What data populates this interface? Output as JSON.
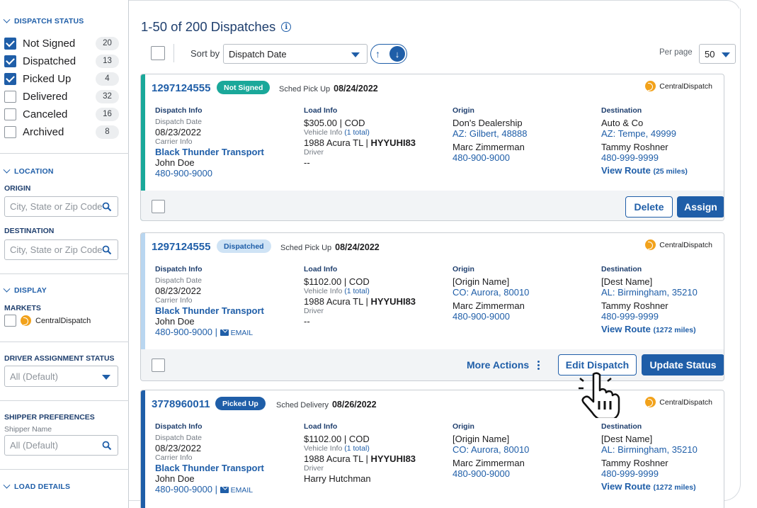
{
  "sidebar": {
    "dispatch_status": {
      "heading": "DISPATCH STATUS",
      "items": [
        {
          "label": "Not Signed",
          "count": "20",
          "checked": true
        },
        {
          "label": "Dispatched",
          "count": "13",
          "checked": true
        },
        {
          "label": "Picked Up",
          "count": "4",
          "checked": true
        },
        {
          "label": "Delivered",
          "count": "32",
          "checked": false
        },
        {
          "label": "Canceled",
          "count": "16",
          "checked": false
        },
        {
          "label": "Archived",
          "count": "8",
          "checked": false
        }
      ]
    },
    "location": {
      "heading": "LOCATION",
      "origin_label": "ORIGIN",
      "origin_placeholder": "City, State or Zip Code",
      "destination_label": "DESTINATION",
      "destination_placeholder": "City, State or Zip Code"
    },
    "display": {
      "heading": "DISPLAY",
      "markets_label": "MARKETS",
      "market_option": "CentralDispatch"
    },
    "driver_assignment": {
      "label": "DRIVER ASSIGNMENT STATUS",
      "value": "All (Default)"
    },
    "shipper": {
      "label": "SHIPPER PREFERENCES",
      "sub": "Shipper Name",
      "value": "All (Default)"
    },
    "load_details": {
      "heading": "LOAD DETAILS"
    }
  },
  "header": {
    "title": "1-50 of 200 Dispatches",
    "info_icon": "i",
    "sort_label": "Sort by",
    "sort_value": "Dispatch Date",
    "per_page_label": "Per page",
    "per_page_value": "50"
  },
  "brand": {
    "logo_text": "CentralDispatch",
    "accent": "#1f5ea8",
    "logo_color": "#f2a21b"
  },
  "cards": [
    {
      "id": "1297124555",
      "status": "Not Signed",
      "status_bg": "#1aa89a",
      "status_fg": "#ffffff",
      "accent": "#1aa89a",
      "sched_label": "Sched Pick Up",
      "sched_date": "08/24/2022",
      "dispatch": {
        "heading": "Dispatch Info",
        "date_label": "Dispatch Date",
        "date": "08/23/2022",
        "carrier_label": "Carrier Info",
        "carrier": "Black Thunder Transport",
        "contact": "John Doe",
        "phone": "480-900-9000",
        "email": ""
      },
      "load": {
        "heading": "Load Info",
        "price": "$305.00 | COD",
        "vehicle_label": "Vehicle Info",
        "vehicle_total": "(1 total)",
        "vehicle_model": "1988 Acura TL | ",
        "vehicle_plate": "HYYUHI83",
        "driver_label": "Driver",
        "driver": "--"
      },
      "origin": {
        "heading": "Origin",
        "name": "Don's Dealership",
        "location": "AZ: Gilbert, 48888",
        "contact": "Marc Zimmerman",
        "phone": "480-900-9000"
      },
      "destination": {
        "heading": "Destination",
        "name": "Auto & Co",
        "location": "AZ: Tempe, 49999",
        "contact": "Tammy Roshner",
        "phone": "480-999-9999",
        "route": "View Route",
        "miles": "(25 miles)"
      },
      "actions": {
        "delete": "Delete",
        "assign": "Assign"
      }
    },
    {
      "id": "1297124555",
      "status": "Dispatched",
      "status_bg": "#cfe3f5",
      "status_fg": "#1f5ea8",
      "accent": "#b9d6f0",
      "sched_label": "Sched Pick Up",
      "sched_date": "08/24/2022",
      "dispatch": {
        "heading": "Dispatch Info",
        "date_label": "Dispatch Date",
        "date": "08/23/2022",
        "carrier_label": "Carrier Info",
        "carrier": "Black Thunder Transport",
        "contact": "John Doe",
        "phone": "480-900-9000 | ",
        "email": "EMAIL"
      },
      "load": {
        "heading": "Load Info",
        "price": "$1102.00 | COD",
        "vehicle_label": "Vehicle Info",
        "vehicle_total": "(1 total)",
        "vehicle_model": "1988 Acura TL | ",
        "vehicle_plate": "HYYUHI83",
        "driver_label": "Driver",
        "driver": "--"
      },
      "origin": {
        "heading": "Origin",
        "name": "[Origin Name]",
        "location": "CO: Aurora, 80010",
        "contact": "Marc Zimmerman",
        "phone": "480-900-9000"
      },
      "destination": {
        "heading": "Destination",
        "name": "[Dest Name]",
        "location": "AL: Birmingham, 35210",
        "contact": "Tammy Roshner",
        "phone": "480-999-9999",
        "route": "View Route",
        "miles": "(1272 miles)"
      },
      "actions": {
        "more": "More Actions",
        "edit": "Edit Dispatch",
        "update": "Update Status"
      }
    },
    {
      "id": "3778960011",
      "status": "Picked Up",
      "status_bg": "#1f5ea8",
      "status_fg": "#ffffff",
      "accent": "#1f5ea8",
      "sched_label": "Sched Delivery",
      "sched_date": "08/26/2022",
      "dispatch": {
        "heading": "Dispatch Info",
        "date_label": "Dispatch Date",
        "date": "08/23/2022",
        "carrier_label": "Carrier Info",
        "carrier": "Black Thunder Transport",
        "contact": "John Doe",
        "phone": "480-900-9000 | ",
        "email": "EMAIL"
      },
      "load": {
        "heading": "Load Info",
        "price": "$1102.00 | COD",
        "vehicle_label": "Vehicle Info",
        "vehicle_total": "(1 total)",
        "vehicle_model": "1988 Acura TL | ",
        "vehicle_plate": "HYYUHI83",
        "driver_label": "Driver",
        "driver": "Harry Hutchman"
      },
      "origin": {
        "heading": "Origin",
        "name": "[Origin Name]",
        "location": "CO: Aurora, 80010",
        "contact": "Marc Zimmerman",
        "phone": "480-900-9000"
      },
      "destination": {
        "heading": "Destination",
        "name": "[Dest Name]",
        "location": "AL: Birmingham, 35210",
        "contact": "Tammy Roshner",
        "phone": "480-999-9999",
        "route": "View Route",
        "miles": "(1272 miles)"
      }
    }
  ]
}
